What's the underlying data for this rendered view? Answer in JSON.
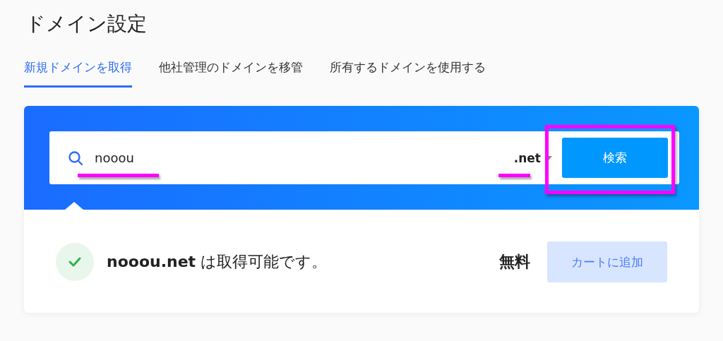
{
  "title": "ドメイン設定",
  "tabs": [
    {
      "label": "新規ドメインを取得",
      "selected": true
    },
    {
      "label": "他社管理のドメインを移管",
      "selected": false
    },
    {
      "label": "所有するドメインを使用する",
      "selected": false
    }
  ],
  "search": {
    "value": "nooou",
    "tld": ".net",
    "button": "検索"
  },
  "result": {
    "available": true,
    "message": "**nooou.net** は取得可能です。",
    "price": "無料",
    "button": "カートに追加"
  }
}
